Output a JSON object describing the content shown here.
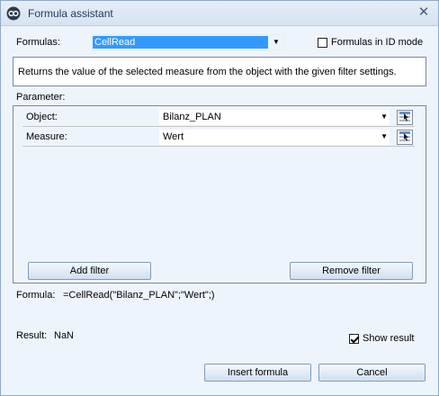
{
  "window": {
    "title": "Formula assistant",
    "icons": {
      "app": "app-logo-icon",
      "close": "close-icon"
    }
  },
  "formulas": {
    "label": "Formulas:",
    "selected": "CellRead",
    "id_mode_label": "Formulas in ID mode",
    "id_mode_checked": false
  },
  "description": "Returns the value of the selected measure from the object with the given filter settings.",
  "parameters": {
    "label": "Parameter:",
    "rows": [
      {
        "name": "Object:",
        "value": "Bilanz_PLAN"
      },
      {
        "name": "Measure:",
        "value": "Wert"
      }
    ],
    "add_filter": "Add filter",
    "remove_filter": "Remove filter"
  },
  "formula": {
    "label": "Formula:",
    "expression": "=CellRead(\"Bilanz_PLAN\";\"Wert\";)"
  },
  "result": {
    "label": "Result:",
    "value": "NaN",
    "show_result_label": "Show result",
    "show_result_checked": true
  },
  "actions": {
    "insert": "Insert formula",
    "cancel": "Cancel"
  }
}
